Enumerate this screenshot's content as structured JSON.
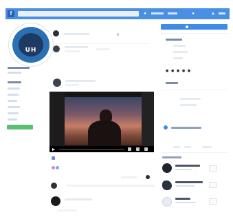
{
  "header": {
    "logo_glyph": "f",
    "icons": [
      "home-icon",
      "bell-icon",
      "profile-icon"
    ]
  },
  "profile": {
    "avatar_initials": "UH",
    "nav_items": [
      "",
      "",
      "",
      "",
      "",
      "",
      ""
    ]
  },
  "feed": {
    "video_post": {
      "controls": [
        "play-icon",
        "settings-icon",
        "volume-icon",
        "fullscreen-icon"
      ]
    }
  },
  "sidebar": {
    "rating_symbols": "● ● ● ● ●",
    "rating_caption": "",
    "info_link": ""
  },
  "colors": {
    "topbar": "#4a90e2",
    "accent": "#3d8ce6",
    "green": "#5cbd74"
  }
}
